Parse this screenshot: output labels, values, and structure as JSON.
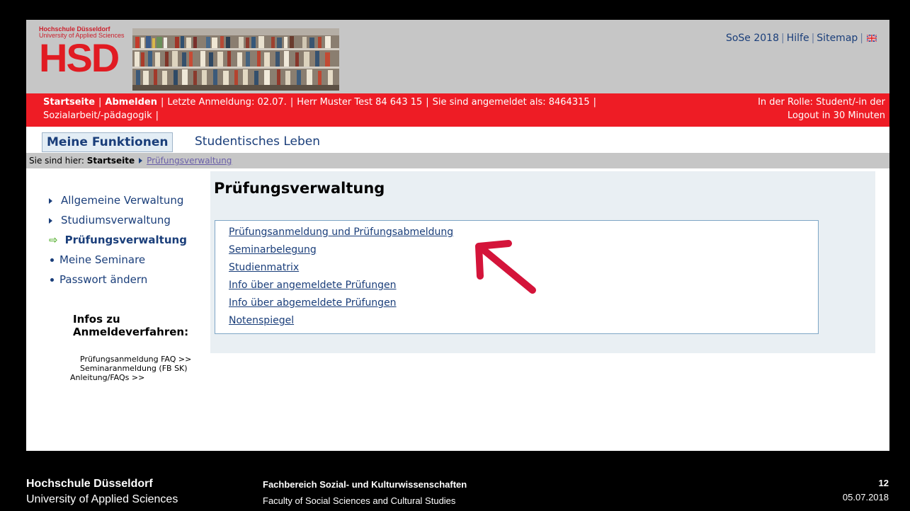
{
  "header": {
    "logo_line1": "Hochschule Düsseldorf",
    "logo_line2": "University of Applied Sciences",
    "logo_big": "HSD",
    "toplinks": [
      "SoSe 2018",
      "Hilfe",
      "Sitemap"
    ],
    "flag_icon": "uk-flag-icon"
  },
  "redbar": {
    "startseite": "Startseite",
    "abmelden": "Abmelden",
    "last_login": "Letzte Anmeldung: 02.07.",
    "user": "Herr Muster Test 84 643 15",
    "logged_in_as": "Sie sind angemeldet als: 8464315",
    "role": "In der Rolle: Student/-in der",
    "program": "Sozialarbeit/-pädagogik",
    "logout": "Logout in 30 Minuten"
  },
  "tabs": {
    "active": "Meine Funktionen",
    "second": "Studentisches Leben"
  },
  "breadcrumb": {
    "prefix": "Sie sind hier:",
    "home": "Startseite",
    "current": "Prüfungsverwaltung"
  },
  "sidebar": {
    "items": [
      {
        "label": "Allgemeine Verwaltung"
      },
      {
        "label": "Studiumsverwaltung"
      },
      {
        "label": "Prüfungsverwaltung"
      },
      {
        "label": "Meine Seminare"
      },
      {
        "label": "Passwort ändern"
      }
    ],
    "infos_title_1": "Infos zu",
    "infos_title_2": "Anmeldeverfahren:",
    "faq_1": "Prüfungsanmeldung FAQ >>",
    "faq_2": "Seminaranmeldung (FB SK)",
    "faq_3": "Anleitung/FAQs >>"
  },
  "main": {
    "title": "Prüfungsverwaltung",
    "links": [
      "Prüfungsanmeldung und Prüfungsabmeldung",
      "Seminarbelegung",
      "Studienmatrix",
      "Info über angemeldete Prüfungen",
      "Info über abgemeldete Prüfungen",
      "Notenspiegel"
    ]
  },
  "footer": {
    "org": "Hochschule Düsseldorf",
    "org_en": "University of Applied Sciences",
    "faculty": "Fachbereich Sozial- und Kulturwissenschaften",
    "faculty_en": "Faculty of Social Sciences and Cultural Studies",
    "page": "12",
    "date": "05.07.2018"
  },
  "colors": {
    "red_bar": "#ee1c25",
    "link_blue": "#1a3e7a",
    "annotation_arrow": "#d4143a"
  }
}
